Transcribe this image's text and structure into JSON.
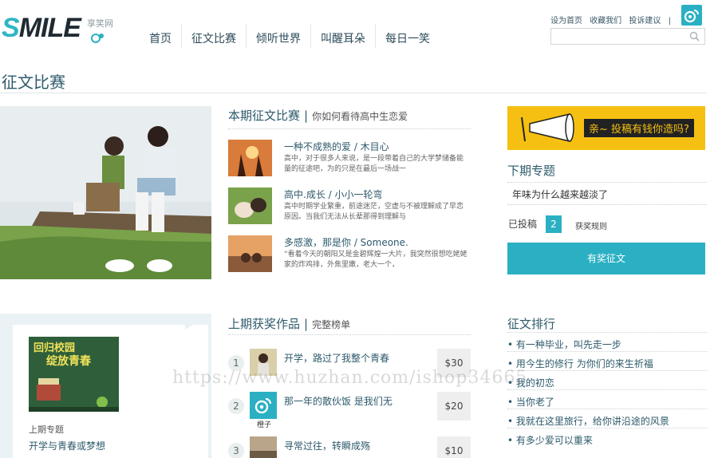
{
  "header": {
    "logo_word": "SMILE",
    "logo_cn": "享笑网",
    "nav": [
      "首页",
      "征文比赛",
      "倾听世界",
      "叫醒耳朵",
      "每日一笑"
    ],
    "top_links": [
      "设为首页",
      "收藏我们",
      "投诉建议",
      "|"
    ],
    "search_placeholder": ""
  },
  "page_title": "征文比赛",
  "current": {
    "heading": "本期征文比赛",
    "sep": "|",
    "subheading": "你如何看待高中生恋爱",
    "stories": [
      {
        "title": "一种不成熟的爱 / 木目心",
        "desc": "高中，对于很多人来说，是一段带着自己的大学梦储备能量的征途吧，为的只是在最后一场战一"
      },
      {
        "title": "高中.成长 / 小小一轮弯",
        "desc": "高中时期学业繁重，前途迷茫，空虚与不被理解成了早恋原因。当我们无法从长辈那得到理解与"
      },
      {
        "title": "多感激，那是你 / Someone.",
        "desc": "“看着今天的朝阳又是金碧辉煌一大片，我突然很想吃姥姥家的炸鸡排，外焦里嫩，老大一个，"
      }
    ]
  },
  "sidebar": {
    "banner_text": "亲~ 投稿有钱你造吗?",
    "next_title": "下期专题",
    "next_item": "年味为什么越来越淡了",
    "submitted_label": "已投稿",
    "submitted_count": "2",
    "rules_link": "获奖规则",
    "award_button": "有奖征文"
  },
  "last": {
    "heading": "上期获奖作品",
    "sep": "|",
    "subheading": "完整榜单",
    "poster_line1": "回归校园",
    "poster_line2": "绽放青春",
    "label": "上期专题",
    "theme": "开学与青春或梦想",
    "winners": [
      {
        "rank": "1",
        "title": "开学，路过了我整个青春",
        "price": "$30"
      },
      {
        "rank": "2",
        "title": "那一年的散伙饭 是我们无",
        "price": "$20",
        "avatar_label": "橙子"
      },
      {
        "rank": "3",
        "title": "寻常过往，转瞬成殇",
        "price": "$10"
      }
    ]
  },
  "ranking": {
    "title": "征文排行",
    "items": [
      "• 有一种毕业，叫先走一步",
      "• 用今生的修行 为你们的来生祈福",
      "• 我的初恋",
      "• 当你老了",
      "• 我就在这里旅行，给你讲沿途的风景",
      "• 有多少爱可以重来"
    ]
  },
  "watermark": "https://www.huzhan.com/ishop34665",
  "colors": {
    "accent": "#2bb0c3",
    "heading": "#2d5a6b",
    "banner": "#f5c012"
  }
}
